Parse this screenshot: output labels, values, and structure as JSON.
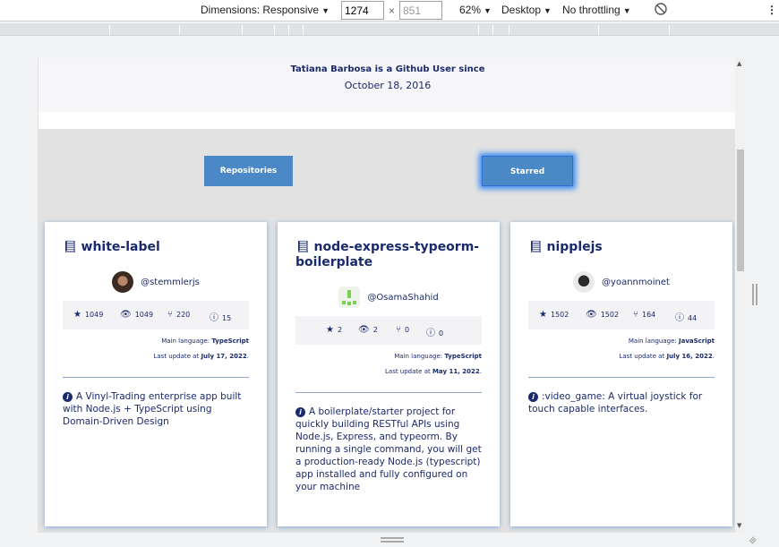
{
  "devtools": {
    "dimensions_label": "Dimensions: Responsive",
    "width_value": "1274",
    "height_value": "851",
    "times": "×",
    "zoom": "62%",
    "device": "Desktop",
    "throttling": "No throttling",
    "rotate_icon": "rotate-icon",
    "more_icon": "⋮"
  },
  "profile": {
    "since_title": "Tatiana Barbosa is a Github User since",
    "since_date": "October 18, 2016"
  },
  "tabs": {
    "repositories": "Repositories",
    "starred": "Starred"
  },
  "labels": {
    "main_language": "Main language: ",
    "last_update": "Last update at "
  },
  "cards": [
    {
      "name": "white-label",
      "owner": "@stemmlerjs",
      "stars": "1049",
      "watchers": "1049",
      "forks": "220",
      "issues": "15",
      "language": "TypeScript",
      "updated": "July 17, 2022",
      "description": "A Vinyl-Trading enterprise app built with Node.js + TypeScript using Domain-Driven Design"
    },
    {
      "name": "node-express-typeorm-boilerplate",
      "owner": "@OsamaShahid",
      "stars": "2",
      "watchers": "2",
      "forks": "0",
      "issues": "0",
      "language": "TypeScript",
      "updated": "May 11, 2022",
      "description": "A boilerplate/starter project for quickly building RESTful APIs using Node.js, Express, and typeorm. By running a single command, you will get a production-ready Node.js (typescript) app installed and fully configured on your machine"
    },
    {
      "name": "nipplejs",
      "owner": "@yoannmoinet",
      "stars": "1502",
      "watchers": "1502",
      "forks": "164",
      "issues": "44",
      "language": "JavaScript",
      "updated": "July 16, 2022",
      "description": ":video_game: A virtual joystick for touch capable interfaces."
    }
  ]
}
